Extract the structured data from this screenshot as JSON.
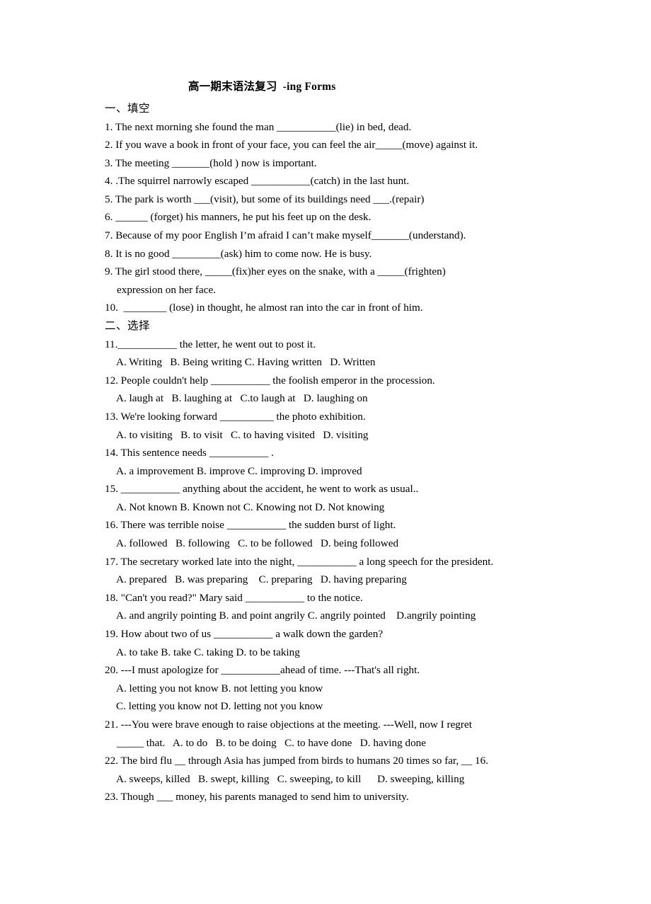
{
  "document": {
    "title": "高一期末语法复习  -ing Forms",
    "sections": [
      {
        "heading": "一、填空",
        "questions": [
          {
            "text": "1. The next morning she found the man ___________(lie) in bed, dead."
          },
          {
            "text": "2. If you wave a book in front of your face, you can feel the air_____(move) against it."
          },
          {
            "text": "3. The meeting _______(hold ) now is important."
          },
          {
            "text": "4. .The squirrel narrowly escaped ___________(catch) in the last hunt."
          },
          {
            "text": "5. The park is worth ___(visit), but some of its buildings need ___.(repair)"
          },
          {
            "text": "6. ______ (forget) his manners, he put his feet up on the desk."
          },
          {
            "text": "7. Because of my poor English I’m afraid I can’t make myself_______(understand)."
          },
          {
            "text": "8. It is no good _________(ask) him to come now. He is busy."
          },
          {
            "text": "9. The girl stood there, _____(fix)her eyes on the snake, with a _____(frighten)",
            "continuation": "expression on her face."
          },
          {
            "text": "10.  ________ (lose) in thought, he almost ran into the car in front of him."
          }
        ]
      },
      {
        "heading": "二、选择",
        "questions": [
          {
            "text": "11.___________ the letter, he went out to post it.",
            "options": "A. Writing   B. Being writing C. Having written   D. Written"
          },
          {
            "text": "12. People couldn't help ___________ the foolish emperor in the procession.",
            "options": "A. laugh at   B. laughing at   C.to laugh at   D. laughing on"
          },
          {
            "text": "13. We're looking forward __________ the photo exhibition.",
            "options": "A. to visiting   B. to visit   C. to having visited   D. visiting"
          },
          {
            "text": "14. This sentence needs ___________ .",
            "options": "A. a improvement B. improve C. improving D. improved"
          },
          {
            "text": "15. ___________ anything about the accident, he went to work as usual..",
            "options": "A. Not known B. Known not C. Knowing not D. Not knowing"
          },
          {
            "text": "16. There was terrible noise ___________ the sudden burst of light.",
            "options": "A. followed   B. following   C. to be followed   D. being followed"
          },
          {
            "text": "17. The secretary worked late into the night, ___________ a long speech for the president.",
            "options": "A. prepared   B. was preparing    C. preparing   D. having preparing"
          },
          {
            "text": "18. \"Can't you read?\" Mary said ___________ to the notice.",
            "options": "A. and angrily pointing B. and point angrily C. angrily pointed    D.angrily pointing"
          },
          {
            "text": "19. How about two of us ___________ a walk down the garden?",
            "options": "A. to take B. take C. taking D. to be taking"
          },
          {
            "text": "20. ---I must apologize for ___________ahead of time. ---That's all right.",
            "options": "A. letting you not know B. not letting you know",
            "options2": "C. letting you know not D. letting not you know"
          },
          {
            "text": "21. ---You were brave enough to raise objections at the meeting. ---Well, now I regret",
            "continuation": "_____ that.   A. to do   B. to be doing   C. to have done   D. having done"
          },
          {
            "text": "22. The bird flu __ through Asia has jumped from birds to humans 20 times so far, __ 16.",
            "options": "A. sweeps, killed   B. swept, killing   C. sweeping, to kill      D. sweeping, killing"
          },
          {
            "text": "23. Though ___ money, his parents managed to send him to university."
          }
        ]
      }
    ]
  }
}
